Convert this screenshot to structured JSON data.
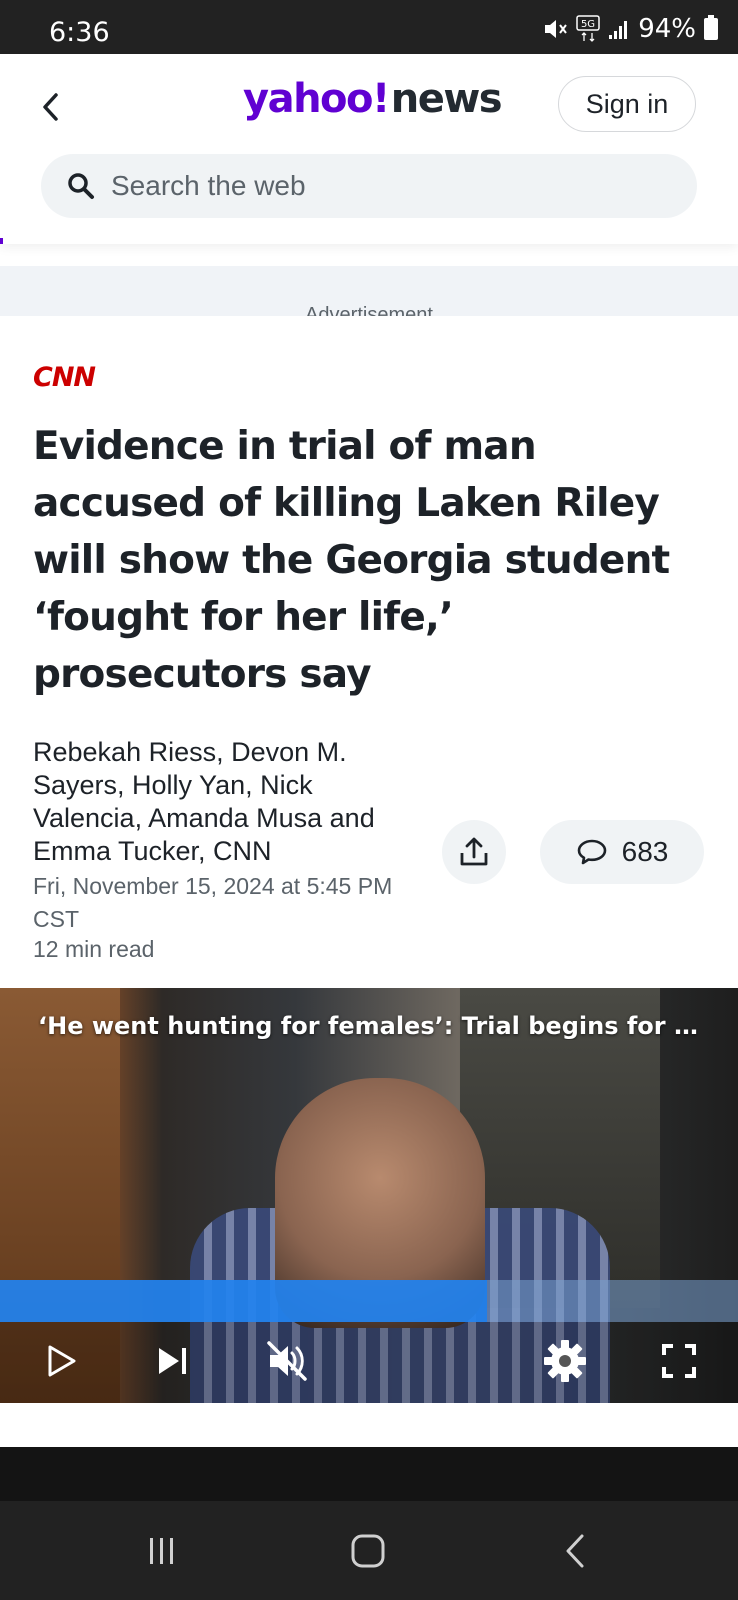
{
  "status_bar": {
    "time": "6:36",
    "battery": "94%",
    "icons": [
      "mute-icon",
      "5g-icon",
      "signal-icon",
      "battery-icon"
    ]
  },
  "header": {
    "logo_yahoo": "yahoo!",
    "logo_news": "news",
    "signin_label": "Sign in",
    "search_placeholder": "Search the web",
    "accent_color": "#6001d2"
  },
  "ad": {
    "label": "Advertisement"
  },
  "article": {
    "provider": "CNN",
    "provider_color": "#cc0000",
    "headline": "Evidence in trial of man accused of killing Laken Riley will show the Georgia student ‘fought for her life,’ prosecutors say",
    "byline": "Rebekah Riess, Devon M. Sayers, Holly Yan, Nick Valencia, Amanda Musa and Emma Tucker, CNN",
    "date": "Fri, November 15, 2024 at 5:45 PM CST",
    "read_time": "12 min read",
    "comment_count": "683"
  },
  "video": {
    "title": "‘He went hunting for females’: Trial begins for mi…",
    "progress_percent": 66,
    "muted": true
  },
  "nav": {
    "buttons": [
      "recents-icon",
      "home-icon",
      "back-icon"
    ]
  }
}
